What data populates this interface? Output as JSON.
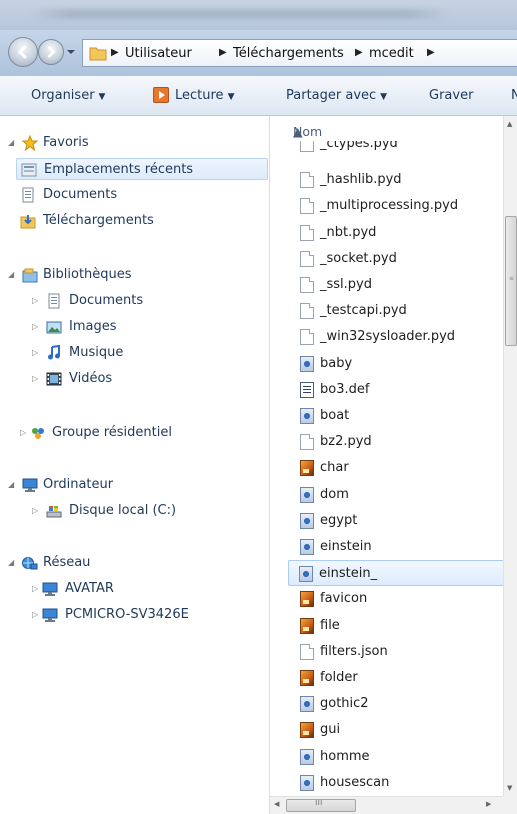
{
  "address_bar": {
    "crumbs": [
      "Utilisateur",
      "Téléchargements",
      "mcedit"
    ]
  },
  "toolbar": {
    "organize": "Organiser",
    "play": "Lecture",
    "share": "Partager avec",
    "burn": "Graver",
    "overflow": "N"
  },
  "navpane": {
    "favorites": "Favoris",
    "recent": "Emplacements récents",
    "documents": "Documents",
    "downloads": "Téléchargements",
    "libraries": "Bibliothèques",
    "lib_documents": "Documents",
    "lib_images": "Images",
    "lib_music": "Musique",
    "lib_videos": "Vidéos",
    "homegroup": "Groupe résidentiel",
    "computer": "Ordinateur",
    "local_disk": "Disque local (C:)",
    "network": "Réseau",
    "host_avatar": "AVATAR",
    "host_pcmicro": "PCMICRO-SV3426E"
  },
  "filepane": {
    "column_name": "Nom",
    "files": [
      {
        "name": "_ctypes.pyd",
        "icon": "document"
      },
      {
        "name": "_hashlib.pyd",
        "icon": "document"
      },
      {
        "name": "_multiprocessing.pyd",
        "icon": "document"
      },
      {
        "name": "_nbt.pyd",
        "icon": "document"
      },
      {
        "name": "_socket.pyd",
        "icon": "document"
      },
      {
        "name": "_ssl.pyd",
        "icon": "document"
      },
      {
        "name": "_testcapi.pyd",
        "icon": "document"
      },
      {
        "name": "_win32sysloader.pyd",
        "icon": "document"
      },
      {
        "name": "baby",
        "icon": "paint"
      },
      {
        "name": "bo3.def",
        "icon": "definition"
      },
      {
        "name": "boat",
        "icon": "paint"
      },
      {
        "name": "bz2.pyd",
        "icon": "document"
      },
      {
        "name": "char",
        "icon": "image"
      },
      {
        "name": "dom",
        "icon": "paint"
      },
      {
        "name": "egypt",
        "icon": "paint"
      },
      {
        "name": "einstein",
        "icon": "paint"
      },
      {
        "name": "einstein_",
        "icon": "paint",
        "selected": true
      },
      {
        "name": "favicon",
        "icon": "image"
      },
      {
        "name": "file",
        "icon": "image"
      },
      {
        "name": "filters.json",
        "icon": "document"
      },
      {
        "name": "folder",
        "icon": "image"
      },
      {
        "name": "gothic2",
        "icon": "paint"
      },
      {
        "name": "gui",
        "icon": "image"
      },
      {
        "name": "homme",
        "icon": "paint"
      },
      {
        "name": "housescan",
        "icon": "paint"
      }
    ]
  }
}
